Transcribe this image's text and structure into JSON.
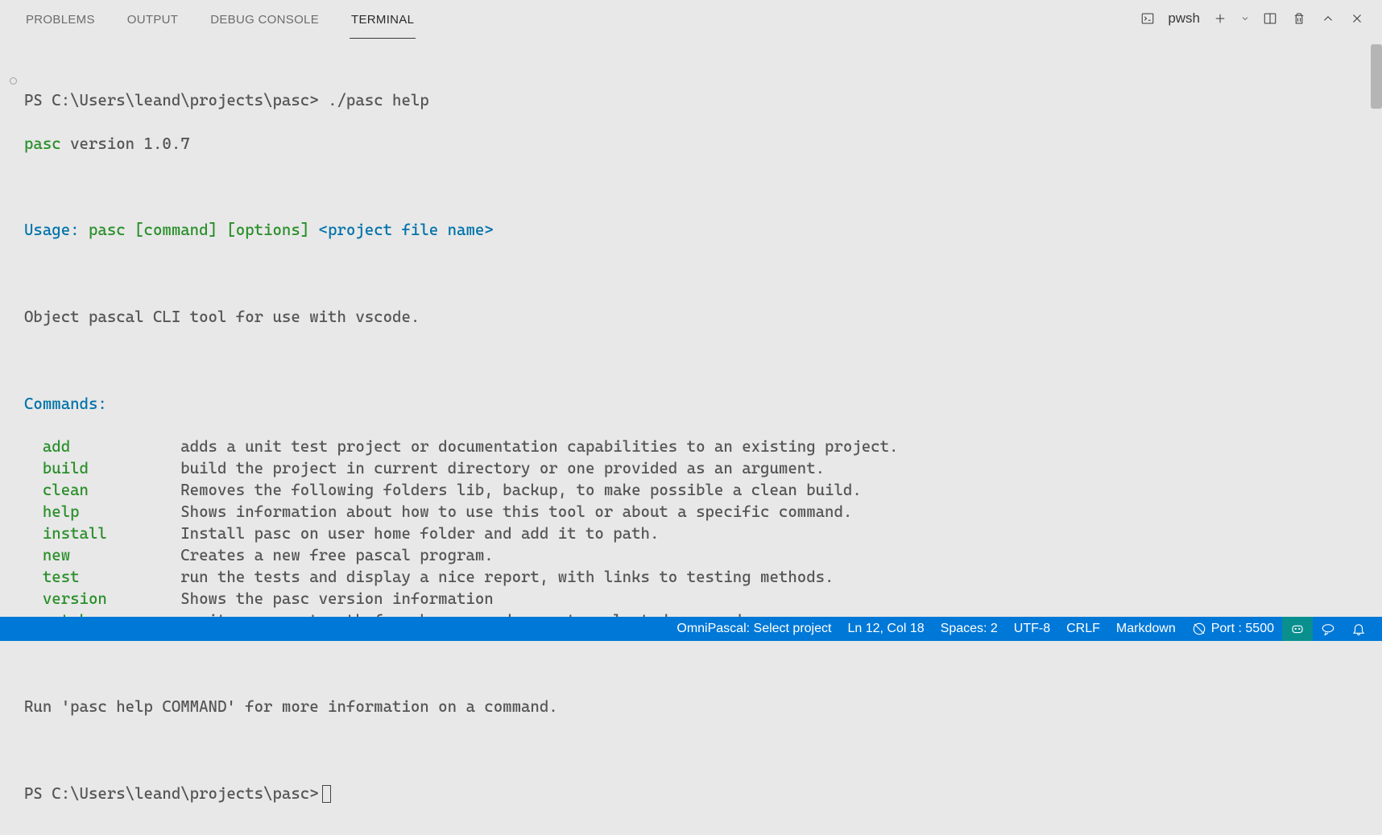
{
  "panel": {
    "tabs": [
      {
        "label": "PROBLEMS"
      },
      {
        "label": "OUTPUT"
      },
      {
        "label": "DEBUG CONSOLE"
      },
      {
        "label": "TERMINAL"
      }
    ],
    "active_tab_index": 3,
    "shell_name": "pwsh"
  },
  "terminal": {
    "prompt1_prefix": "PS ",
    "prompt1_path": "C:\\Users\\leand\\projects\\pasc>",
    "prompt1_cmd": " ./pasc help",
    "version_label": "pasc",
    "version_no": " version 1.0.7",
    "usage_label": "Usage:",
    "usage_cmd": " pasc [command] [options]",
    "usage_rest": " <project file name>",
    "description": "Object pascal CLI tool for use with vscode.",
    "commands_header": "Commands:",
    "commands": [
      {
        "name": "add",
        "desc": "adds a unit test project or documentation capabilities to an existing project."
      },
      {
        "name": "build",
        "desc": "build the project in current directory or one provided as an argument."
      },
      {
        "name": "clean",
        "desc": "Removes the following folders lib, backup, to make possible a clean build."
      },
      {
        "name": "help",
        "desc": "Shows information about how to use this tool or about a specific command."
      },
      {
        "name": "install",
        "desc": "Install pasc on user home folder and add it to path."
      },
      {
        "name": "new",
        "desc": "Creates a new free pascal program."
      },
      {
        "name": "test",
        "desc": "run the tests and display a nice report, with links to testing methods."
      },
      {
        "name": "version",
        "desc": "Shows the pasc version information"
      },
      {
        "name": "watch",
        "desc": "monitor current path for changes and execute selected commands"
      }
    ],
    "footer": "Run 'pasc help COMMAND' for more information on a command.",
    "prompt2_prefix": "PS ",
    "prompt2_path": "C:\\Users\\leand\\projects\\pasc>"
  },
  "statusbar": {
    "omnipascal": "OmniPascal: Select project",
    "position": "Ln 12, Col 18",
    "spaces": "Spaces: 2",
    "encoding": "UTF-8",
    "eol": "CRLF",
    "lang": "Markdown",
    "port": "Port : 5500"
  }
}
